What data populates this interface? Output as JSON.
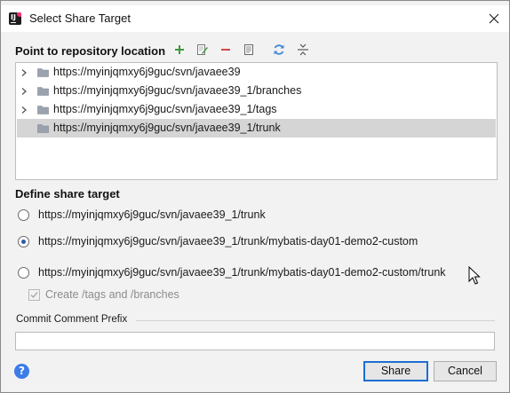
{
  "window": {
    "title": "Select Share Target",
    "app_icon": "intellij-icon"
  },
  "repository": {
    "label": "Point to repository location",
    "toolbar": [
      "add-icon",
      "edit-icon",
      "remove-icon",
      "browse-icon",
      "refresh-icon",
      "collapse-icon"
    ],
    "items": [
      {
        "label": "https://myinjqmxy6j9guc/svn/javaee39",
        "expandable": true,
        "selected": false
      },
      {
        "label": "https://myinjqmxy6j9guc/svn/javaee39_1/branches",
        "expandable": true,
        "selected": false
      },
      {
        "label": "https://myinjqmxy6j9guc/svn/javaee39_1/tags",
        "expandable": true,
        "selected": false
      },
      {
        "label": "https://myinjqmxy6j9guc/svn/javaee39_1/trunk",
        "expandable": false,
        "selected": true
      }
    ]
  },
  "share_target": {
    "label": "Define share target",
    "options": [
      {
        "label": "https://myinjqmxy6j9guc/svn/javaee39_1/trunk",
        "checked": false
      },
      {
        "label": "https://myinjqmxy6j9guc/svn/javaee39_1/trunk/mybatis-day01-demo2-custom",
        "checked": true
      },
      {
        "label": "https://myinjqmxy6j9guc/svn/javaee39_1/trunk/mybatis-day01-demo2-custom/trunk",
        "checked": false
      }
    ],
    "create_tags_label": "Create /tags and /branches",
    "create_tags_checked": true,
    "create_tags_enabled": false
  },
  "commit": {
    "label": "Commit Comment Prefix",
    "value": ""
  },
  "buttons": {
    "help": "?",
    "share": "Share",
    "cancel": "Cancel"
  },
  "colors": {
    "accent": "#2b5dab",
    "toolbar_green": "#3c9a3c",
    "toolbar_red": "#d64545",
    "toolbar_blue": "#3e8ad6",
    "help_blue": "#3b7ce8"
  }
}
